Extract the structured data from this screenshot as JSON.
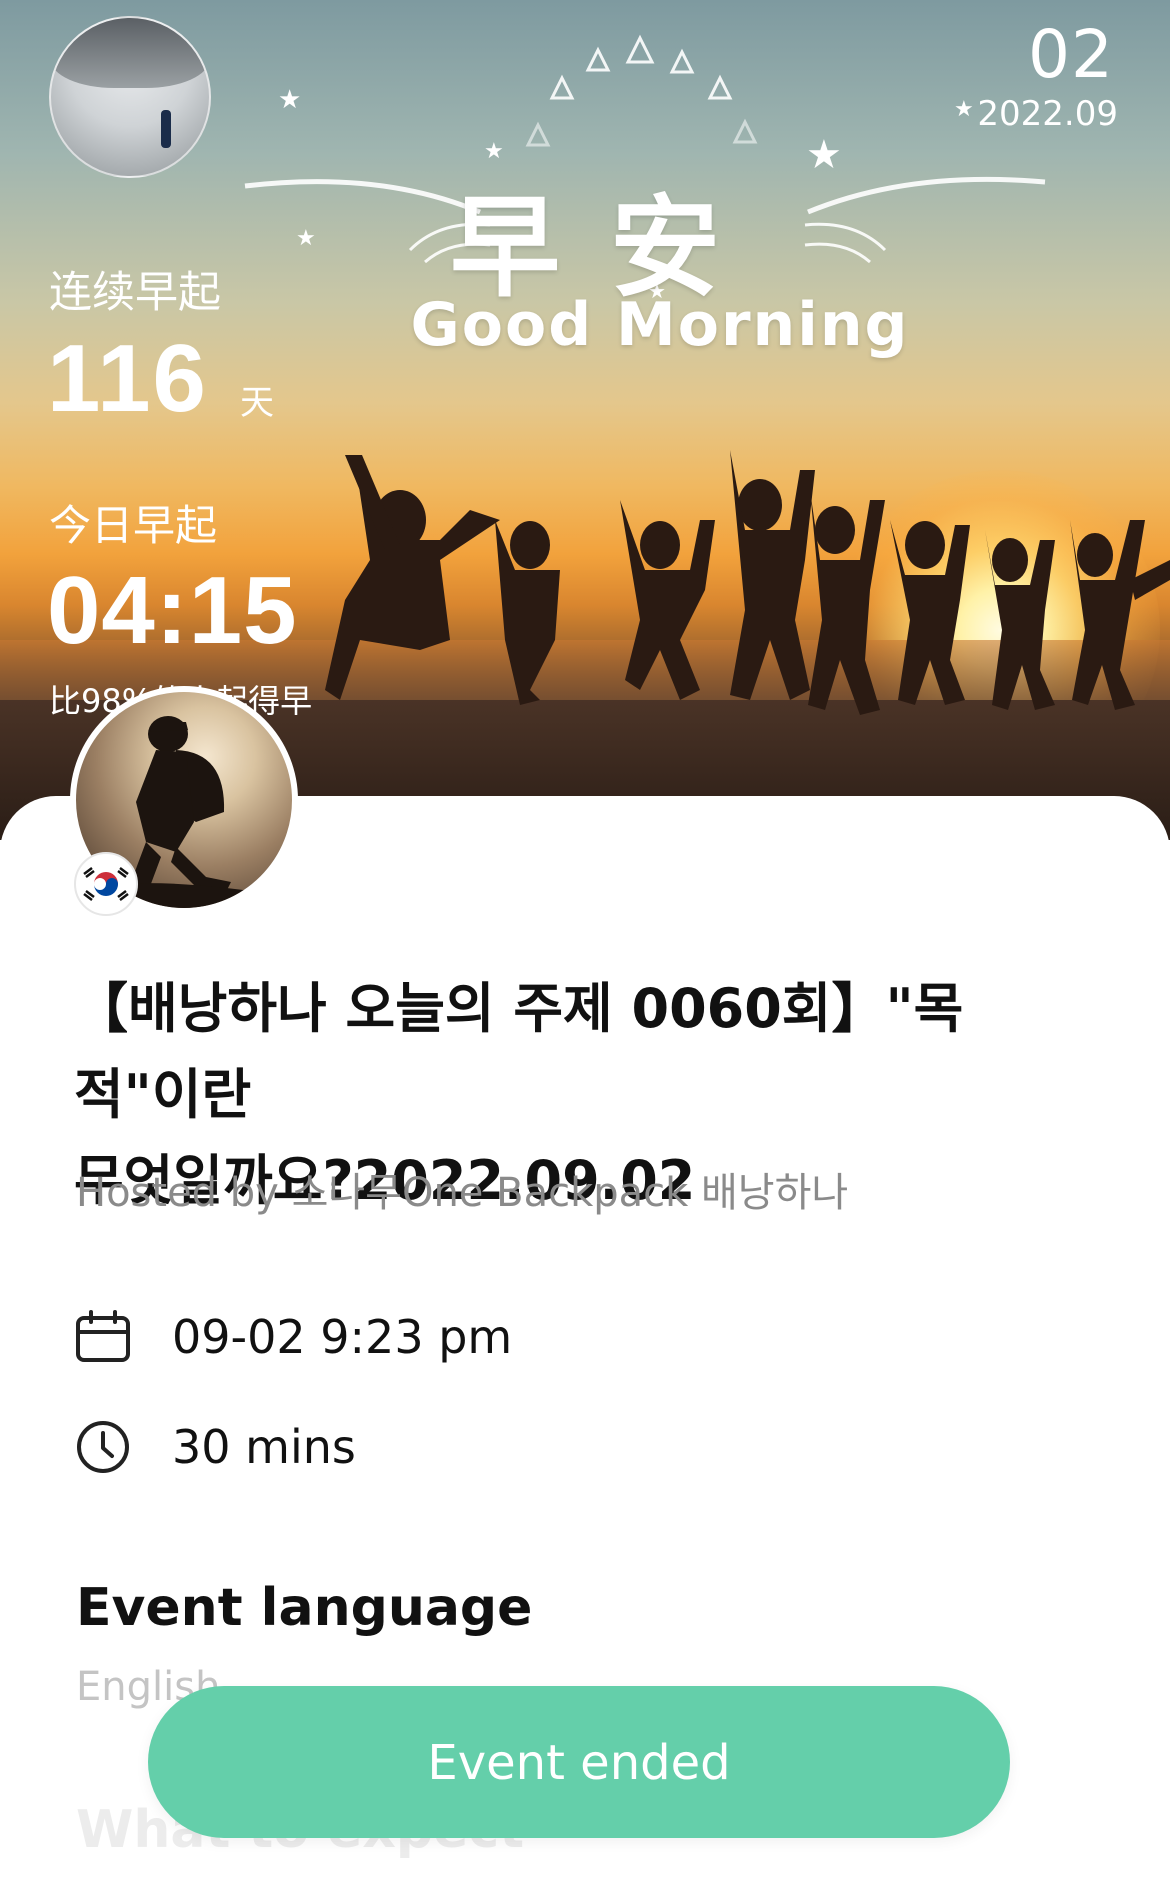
{
  "hero": {
    "day": "02",
    "month": "2022.09",
    "greeting_cn": "早安",
    "greeting_en": "Good Morning",
    "streak_label": "连续早起",
    "streak_value": "116",
    "streak_unit": "天",
    "today_label": "今日早起",
    "today_time": "04:15",
    "today_compare": "比98%的人起得早"
  },
  "event": {
    "title_line1": "【배낭하나 오늘의 주제 0060회】\"목적\"이란",
    "title_line2": "무엇일까요?2022.09.02",
    "hosted_by": "Hosted by 소나무One Backpack 배낭하나",
    "datetime": "09-02 9:23 pm",
    "duration": "30 mins",
    "language_heading": "Event language",
    "language_value": "English",
    "expect_heading": "What to expect",
    "button_label": "Event ended"
  },
  "icons": {
    "calendar": "calendar-icon",
    "clock": "clock-icon",
    "flag": "south-korea-flag-icon"
  },
  "colors": {
    "button": "#64cfaa",
    "title": "#111111",
    "muted": "#8a8a8a"
  }
}
